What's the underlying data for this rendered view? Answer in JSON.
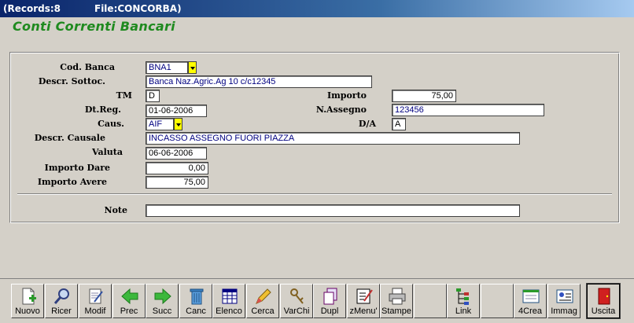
{
  "titlebar": {
    "records": "(Records:8",
    "file": "File:CONCORBA)"
  },
  "form": {
    "title": "Conti Correnti Bancari"
  },
  "labels": {
    "cod_banca": "Cod. Banca",
    "descr_sottoc": "Descr. Sottoc.",
    "tm": "TM",
    "importo": "Importo",
    "dt_reg": "Dt.Reg.",
    "n_assegno": "N.Assegno",
    "caus": "Caus.",
    "da": "D/A",
    "descr_causale": "Descr. Causale",
    "valuta": "Valuta",
    "importo_dare": "Importo Dare",
    "importo_avere": "Importo Avere",
    "note": "Note"
  },
  "values": {
    "cod_banca": "BNA1",
    "descr_sottoc": "Banca Naz.Agric.Ag 10 c/c12345",
    "tm": "D",
    "importo": "75,00",
    "dt_reg": "01-06-2006",
    "n_assegno": "123456",
    "caus": "AIF",
    "da": "A",
    "descr_causale": "INCASSO ASSEGNO FUORI PIAZZA",
    "valuta": "06-06-2006",
    "importo_dare": "0,00",
    "importo_avere": "75,00",
    "note": ""
  },
  "toolbar": {
    "nuovo": "Nuovo",
    "ricer": "Ricer",
    "modif": "Modif",
    "prec": "Prec",
    "succ": "Succ",
    "canc": "Canc",
    "elenco": "Elenco",
    "cerca": "Cerca",
    "varchi": "VarChi",
    "dupl": "Dupl",
    "zmenu": "zMenu'",
    "stampe": "Stampe",
    "link": "Link",
    "crea": "4Crea",
    "immag": "Immag",
    "uscita": "Uscita"
  },
  "colors": {
    "title_green": "#1f8a1f",
    "field_text": "#000080",
    "dropdown": "#ffff00"
  }
}
